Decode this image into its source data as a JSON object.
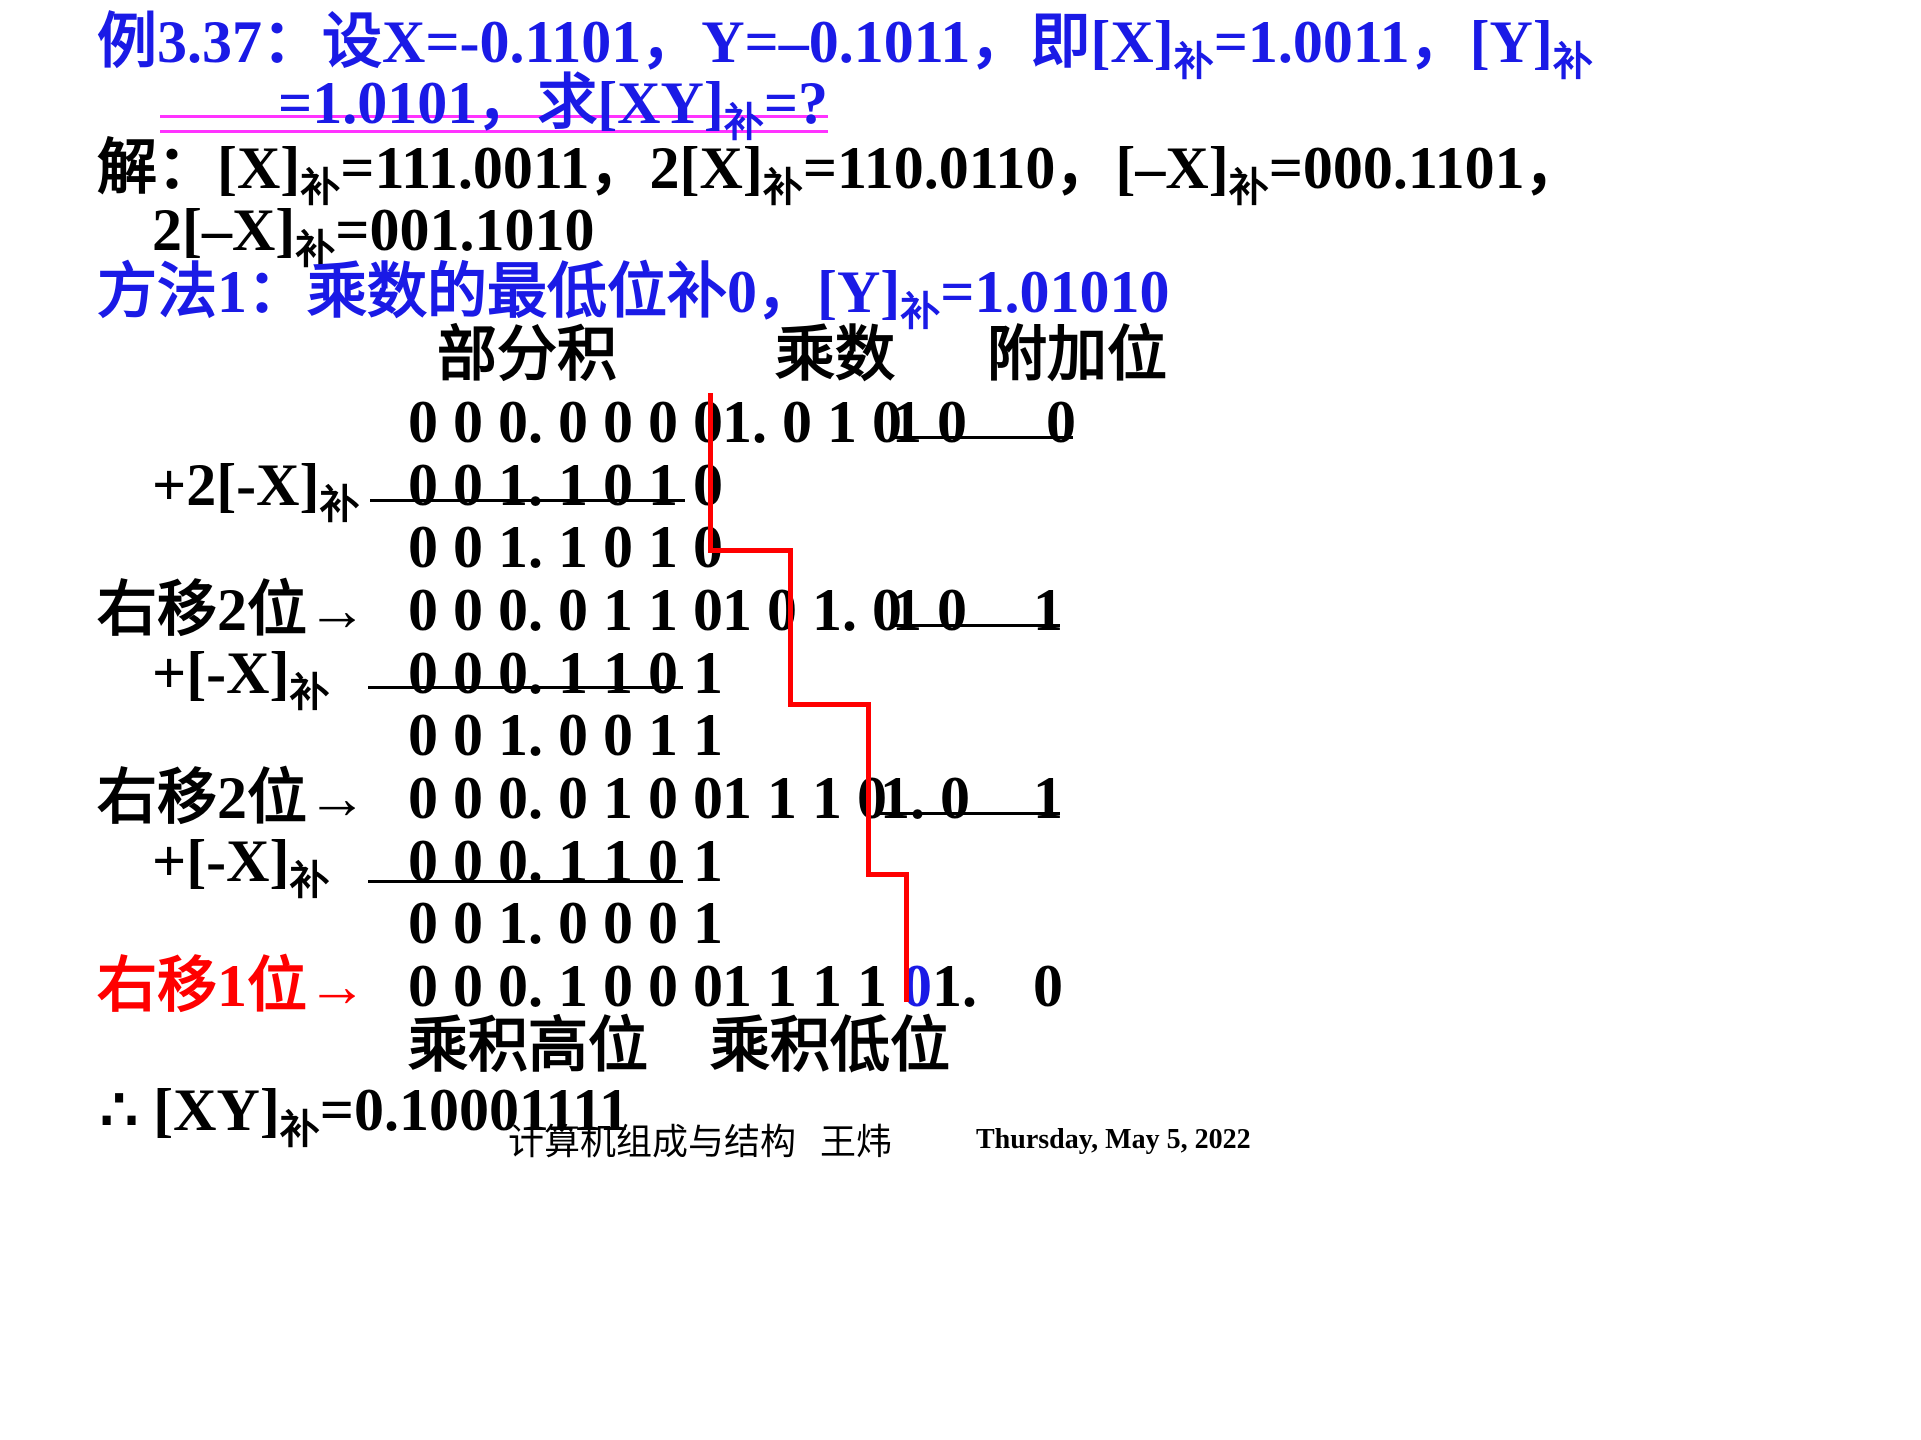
{
  "problem": {
    "line1": {
      "prefix": "例3.37：设X=-0.1101，Y=–0.1011，即[X]",
      "sub1": "补",
      "mid": "=1.0011，[Y]",
      "sub2": "补"
    },
    "line2": {
      "prefix": "=1.0101，求[XY]",
      "sub": "补",
      "suffix": "=?"
    }
  },
  "solution": {
    "line1": {
      "p1": "解：[X]",
      "s1": "补",
      "p2": "=111.0011，2[X]",
      "s2": "补",
      "p3": "=110.0110，[–X]",
      "s3": "补",
      "p4": "=000.1101，"
    },
    "line2": {
      "p1": "2[–X]",
      "s1": "补",
      "p2": "=001.1010"
    }
  },
  "method": {
    "prefix": "方法1：乘数的最低位补0，[Y]",
    "sub": "补",
    "suffix": "=1.01010"
  },
  "headers": {
    "partial": "部分积",
    "multiplier": "乘数",
    "extra": "附加位"
  },
  "rows": {
    "r1": {
      "partial": "0 0 0. 0 0 0 0",
      "mult": "1. 0 1 0",
      "mult_u": "1 0",
      "extra": "0"
    },
    "r2": {
      "label": "+2[-X]",
      "label_sub": "补",
      "partial": "0 0 1. 1 0 1 0"
    },
    "r3": {
      "partial": "0 0 1. 1 0 1 0"
    },
    "r4": {
      "label": "右移2位→",
      "partial": "0 0 0. 0 1 1 0",
      "mult": "1 0 1. 0",
      "mult_u": "1 0",
      "extra": "1"
    },
    "r5": {
      "label": "+[-X]",
      "label_sub": "补",
      "partial": "0 0 0. 1 1 0 1"
    },
    "r6": {
      "partial": "0 0 1. 0 0 1 1"
    },
    "r7": {
      "label": "右移2位→",
      "partial": "0 0 0. 0 1 0 0",
      "mult": "1 1 1 0",
      "mult_u": "1. 0",
      "extra": "1"
    },
    "r8": {
      "label": "+[-X]",
      "label_sub": "补",
      "partial": "0 0 0. 1 1 0 1"
    },
    "r9": {
      "partial": "0 0 1. 0 0 0 1"
    },
    "r10": {
      "label": "右移1位→",
      "partial": "0 0 0. 1 0 0 0",
      "mult_a": "1 1 1 1",
      "mult_blue": "0",
      "mult_b": "1.",
      "extra": "0"
    }
  },
  "bottom": {
    "high": "乘积高位",
    "low": "乘积低位"
  },
  "result": {
    "prefix": "∴ [XY]",
    "sub": "补",
    "suffix": "=0.10001111"
  },
  "footer": {
    "course": "计算机组成与结构",
    "author": "王炜",
    "date": "Thursday, May 5, 2022"
  },
  "colors": {
    "heading": "#1a1ae6",
    "highlight": "#ff0000",
    "underline": "#ff33ff"
  }
}
